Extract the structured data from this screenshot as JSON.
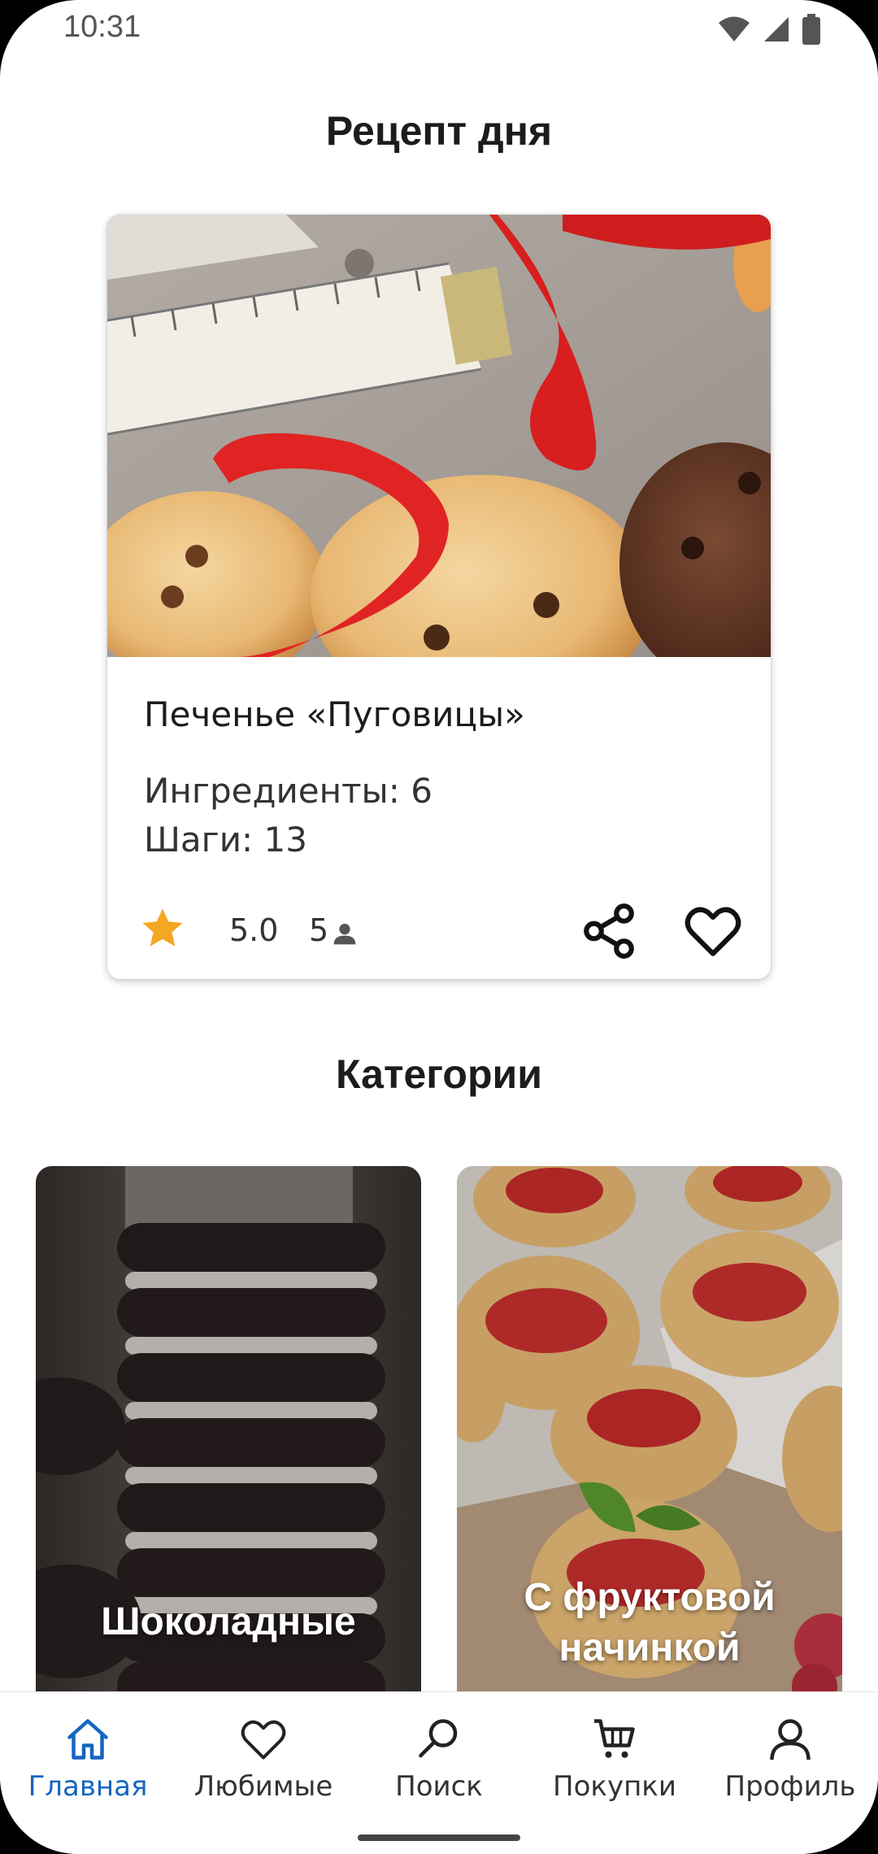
{
  "status_bar": {
    "time": "10:31",
    "icons": [
      "wifi-icon",
      "signal-icon",
      "battery-icon"
    ]
  },
  "recipe_of_day": {
    "section_title": "Рецепт  дня",
    "name": "Печенье «Пуговицы»",
    "ingredients_text": "Ингредиенты: 6",
    "steps_text": "Шаги: 13",
    "rating": "5.0",
    "reviews": "5"
  },
  "categories": {
    "section_title": "Категории",
    "items": [
      {
        "label": "Шоколадные"
      },
      {
        "label": "С  фруктовой начинкой"
      }
    ]
  },
  "bottom_nav": {
    "items": [
      {
        "label": "Главная",
        "icon": "home-icon",
        "active": true
      },
      {
        "label": "Любимые",
        "icon": "heart-icon",
        "active": false
      },
      {
        "label": "Поиск",
        "icon": "search-icon",
        "active": false
      },
      {
        "label": "Покупки",
        "icon": "cart-icon",
        "active": false
      },
      {
        "label": "Профиль",
        "icon": "profile-icon",
        "active": false
      }
    ]
  },
  "colors": {
    "accent": "#1565c0",
    "star": "#f5a623",
    "text": "#1c1c1c"
  }
}
